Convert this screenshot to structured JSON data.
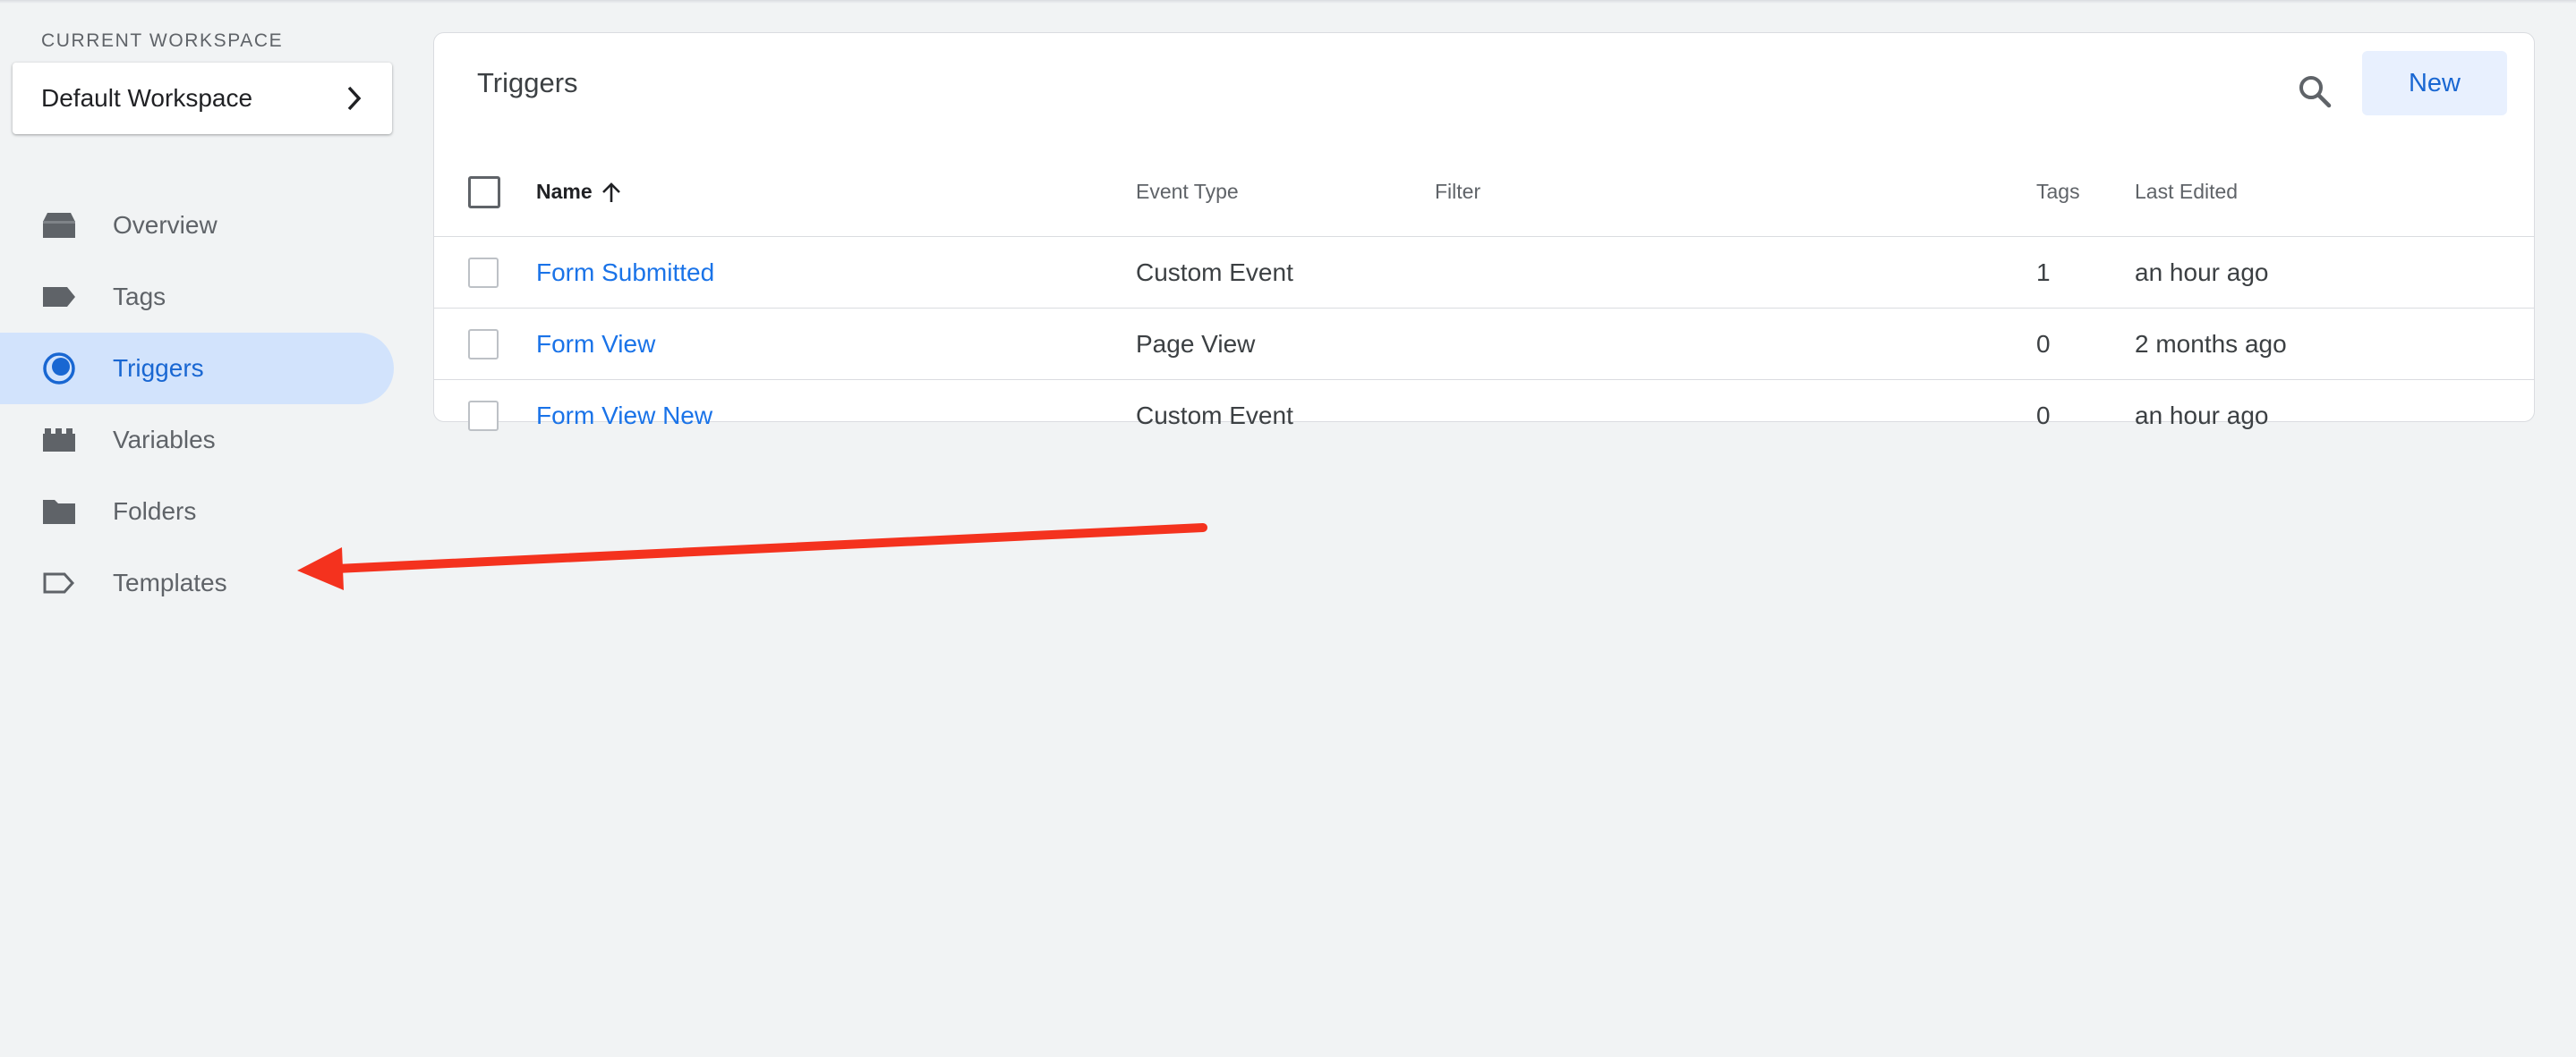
{
  "sidebar": {
    "workspace_label": "CURRENT WORKSPACE",
    "workspace_name": "Default Workspace",
    "items": [
      {
        "label": "Overview",
        "icon": "overview-icon"
      },
      {
        "label": "Tags",
        "icon": "tag-icon"
      },
      {
        "label": "Triggers",
        "icon": "trigger-icon",
        "active": true
      },
      {
        "label": "Variables",
        "icon": "variables-icon"
      },
      {
        "label": "Folders",
        "icon": "folder-icon"
      },
      {
        "label": "Templates",
        "icon": "template-icon"
      }
    ]
  },
  "main": {
    "title": "Triggers",
    "new_label": "New",
    "columns": {
      "name": "Name",
      "event_type": "Event Type",
      "filter": "Filter",
      "tags": "Tags",
      "last_edited": "Last Edited"
    },
    "rows": [
      {
        "name": "Form Submitted",
        "event_type": "Custom Event",
        "filter": "",
        "tags": "1",
        "last_edited": "an hour ago"
      },
      {
        "name": "Form View",
        "event_type": "Page View",
        "filter": "",
        "tags": "0",
        "last_edited": "2 months ago"
      },
      {
        "name": "Form View New",
        "event_type": "Custom Event",
        "filter": "",
        "tags": "0",
        "last_edited": "an hour ago"
      }
    ]
  },
  "colors": {
    "accent": "#1a73e8",
    "active_nav_bg": "#d2e3fc",
    "annotation_arrow": "#f4321e"
  }
}
